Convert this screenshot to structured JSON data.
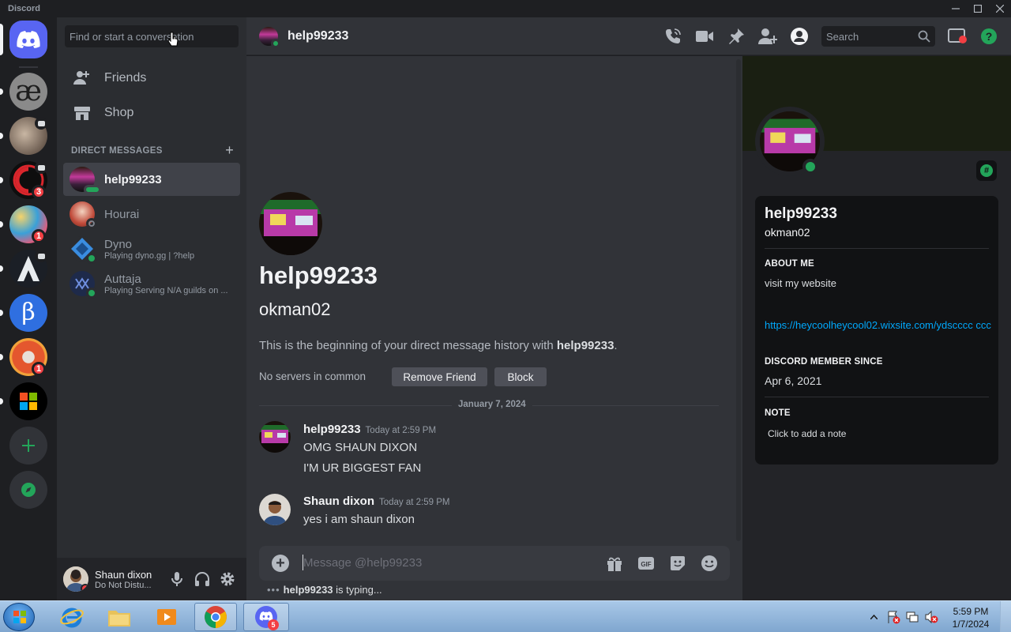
{
  "window": {
    "title": "Discord"
  },
  "servers": [
    {
      "name": "Direct Messages",
      "badge": ""
    },
    {
      "name": "ae server",
      "badge": ""
    },
    {
      "name": "cat server",
      "badge": ""
    },
    {
      "name": "red server",
      "badge": "3"
    },
    {
      "name": "game server",
      "badge": "1"
    },
    {
      "name": "mountain server",
      "badge": ""
    },
    {
      "name": "beta server",
      "badge": ""
    },
    {
      "name": "orange server",
      "badge": "1"
    },
    {
      "name": "tiles server",
      "badge": ""
    }
  ],
  "sidebar": {
    "search_placeholder": "Find or start a conversation",
    "nav": [
      {
        "label": "Friends"
      },
      {
        "label": "Shop"
      }
    ],
    "dm_header": "DIRECT MESSAGES",
    "dms": [
      {
        "name": "help99233",
        "sub": ""
      },
      {
        "name": "Hourai",
        "sub": ""
      },
      {
        "name": "Dyno",
        "sub": "Playing dyno.gg | ?help"
      },
      {
        "name": "Auttaja",
        "sub": "Playing Serving N/A guilds on ..."
      }
    ]
  },
  "user_panel": {
    "name": "Shaun dixon",
    "status": "Do Not Distu..."
  },
  "header": {
    "name": "help99233",
    "search_placeholder": "Search"
  },
  "chat": {
    "welcome_name": "help99233",
    "welcome_handle": "okman02",
    "welcome_prefix": "This is the beginning of your direct message history with ",
    "welcome_bold": "help99233",
    "welcome_suffix": ".",
    "no_servers": "No servers in common",
    "remove_friend": "Remove Friend",
    "block": "Block",
    "date_divider": "January 7, 2024",
    "messages": [
      {
        "author": "help99233",
        "time": "Today at 2:59 PM",
        "lines": [
          "OMG SHAUN DIXON",
          "I'M UR BIGGEST FAN"
        ]
      },
      {
        "author": "Shaun dixon",
        "time": "Today at 2:59 PM",
        "lines": [
          "yes i am shaun dixon"
        ]
      }
    ],
    "composer_placeholder": "Message @help99233",
    "typing_user": "help99233",
    "typing_suffix": " is typing..."
  },
  "profile": {
    "name": "help99233",
    "handle": "okman02",
    "about_header": "ABOUT ME",
    "about_text": "visit my website",
    "about_link": "https://heycoolheycool02.wixsite.com/ydscccc ccc",
    "member_header": "DISCORD MEMBER SINCE",
    "member_since": "Apr 6, 2021",
    "note_header": "NOTE",
    "note_placeholder": "Click to add a note"
  },
  "taskbar": {
    "discord_badge": "5",
    "time": "5:59 PM",
    "date": "1/7/2024"
  },
  "colors": {
    "blurple": "#5865f2",
    "online": "#23a55a",
    "dnd": "#f23f43",
    "link": "#00a8fc"
  }
}
